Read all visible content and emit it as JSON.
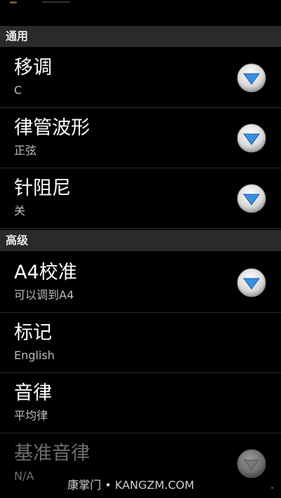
{
  "sections": [
    {
      "label": "通用"
    },
    {
      "label": "高级"
    }
  ],
  "preferences": [
    {
      "title": "移调",
      "summary": "C",
      "icon": "chevron-down-icon",
      "enabled": true
    },
    {
      "title": "律管波形",
      "summary": "正弦",
      "icon": "chevron-down-icon",
      "enabled": true
    },
    {
      "title": "针阻尼",
      "summary": "关",
      "icon": "chevron-down-icon",
      "enabled": true
    },
    {
      "title": "A4校准",
      "summary": "可以调到A4",
      "icon": "chevron-down-icon",
      "enabled": true
    },
    {
      "title": "标记",
      "summary": "English",
      "enabled": true
    },
    {
      "title": "音律",
      "summary": "平均律",
      "enabled": true
    },
    {
      "title": "基准音律",
      "summary": "N/A",
      "icon": "chevron-down-icon",
      "enabled": false
    }
  ],
  "watermark": "康掌门 • KANGZM.COM",
  "colors": {
    "icon_active_blue": "#3a8fe0",
    "icon_disabled_gray": "#777777",
    "section_bg": "#2a2a2a"
  }
}
